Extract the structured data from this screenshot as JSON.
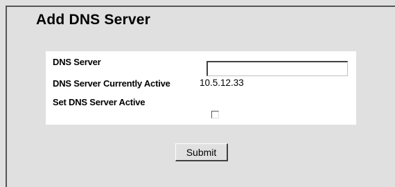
{
  "page": {
    "title": "Add DNS Server"
  },
  "form": {
    "dns_server_label": "DNS Server",
    "dns_server_value": "",
    "currently_active_label": "DNS Server Currently Active",
    "currently_active_value": "10.5.12.33",
    "set_active_label": "Set DNS Server Active",
    "set_active_checked": false
  },
  "actions": {
    "submit_label": "Submit"
  }
}
